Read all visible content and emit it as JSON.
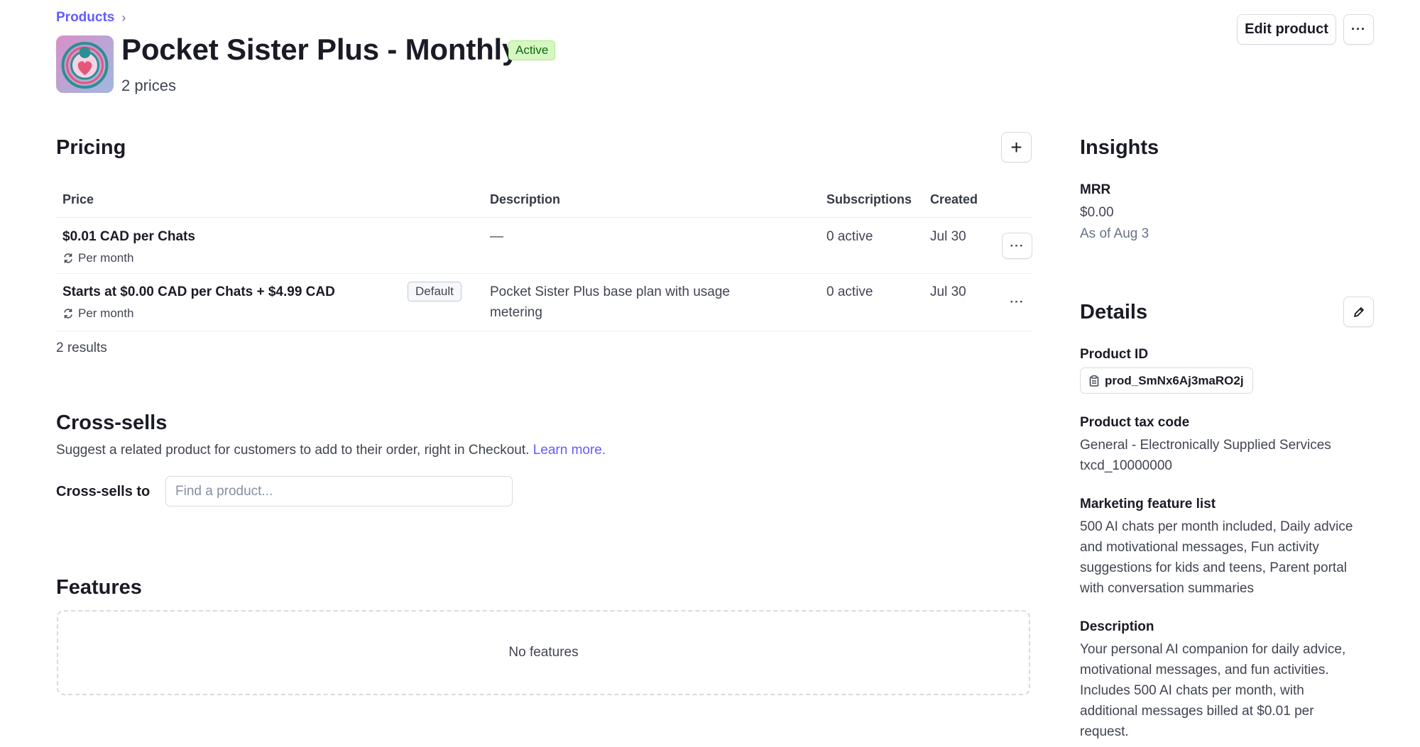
{
  "breadcrumb": {
    "root": "Products",
    "separator": "›"
  },
  "product": {
    "name": "Pocket Sister Plus - Monthly",
    "status": "Active",
    "price_count": "2 prices"
  },
  "header_actions": {
    "edit_label": "Edit product",
    "more_label": "···"
  },
  "pricing": {
    "heading": "Pricing",
    "add_label": "+",
    "columns": {
      "price": "Price",
      "description": "Description",
      "subscriptions": "Subscriptions",
      "created": "Created"
    },
    "rows": [
      {
        "price": "$0.01 CAD per Chats",
        "interval": "Per month",
        "badge": "",
        "description": "—",
        "subscriptions": "0 active",
        "created": "Jul 30"
      },
      {
        "price": "Starts at $0.00 CAD per Chats + $4.99 CAD",
        "interval": "Per month",
        "badge": "Default",
        "description_line1": "Pocket Sister Plus base plan with usage",
        "description_line2": "metering",
        "subscriptions": "0 active",
        "created": "Jul 30"
      }
    ],
    "results": "2 results",
    "more_label": "···"
  },
  "cross_sells": {
    "heading": "Cross-sells",
    "description": "Suggest a related product for customers to add to their order, right in Checkout.",
    "learn_more": "Learn more.",
    "label": "Cross-sells to",
    "placeholder": "Find a product..."
  },
  "features": {
    "heading": "Features",
    "empty": "No features"
  },
  "insights": {
    "heading": "Insights",
    "mrr_label": "MRR",
    "mrr_value": "$0.00",
    "as_of": "As of Aug 3"
  },
  "details": {
    "heading": "Details",
    "product_id_label": "Product ID",
    "product_id": "prod_SmNx6Aj3maRO2j",
    "tax_code_label": "Product tax code",
    "tax_code_name": "General - Electronically Supplied Services",
    "tax_code_id": "txcd_10000000",
    "marketing_label": "Marketing feature list",
    "marketing_lines": [
      "500 AI chats per month included, Daily advice",
      "and motivational messages, Fun activity",
      "suggestions for kids and teens, Parent portal",
      "with conversation summaries"
    ],
    "description_label": "Description",
    "description_lines": [
      "Your personal AI companion for daily advice,",
      "motivational messages, and fun activities.",
      "Includes 500 AI chats per month, with",
      "additional messages billed at $0.01 per",
      "request."
    ]
  },
  "colors": {
    "accent": "#635bff",
    "active_bg": "#d7f7c2",
    "active_text": "#05690d"
  },
  "icons": {
    "refresh": "refresh-icon",
    "copy": "copy-icon",
    "pencil": "pencil-icon",
    "chevron": "chevron-right-icon"
  }
}
